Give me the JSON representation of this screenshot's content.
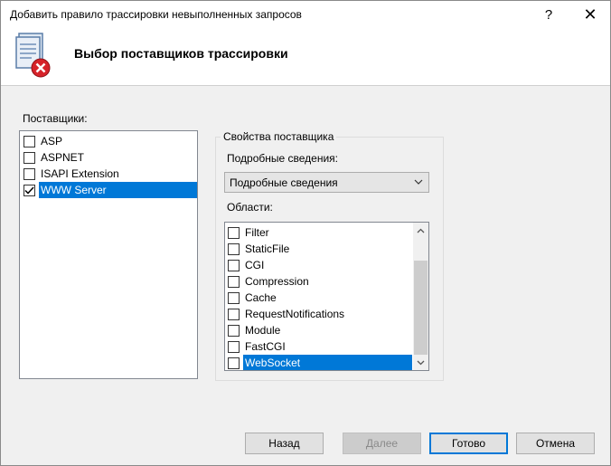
{
  "window": {
    "title": "Добавить правило трассировки невыполненных запросов",
    "help_glyph": "?",
    "close_glyph": "✕"
  },
  "header": {
    "title": "Выбор поставщиков трассировки",
    "icon": "trace-rule-error-icon"
  },
  "providers": {
    "label": "Поставщики:",
    "items": [
      {
        "label": "ASP",
        "checked": false,
        "selected": false
      },
      {
        "label": "ASPNET",
        "checked": false,
        "selected": false
      },
      {
        "label": "ISAPI Extension",
        "checked": false,
        "selected": false
      },
      {
        "label": "WWW Server",
        "checked": true,
        "selected": true
      }
    ]
  },
  "properties": {
    "legend": "Свойства поставщика",
    "verbosity_label": "Подробные сведения:",
    "verbosity_value": "Подробные сведения",
    "areas_label": "Области:",
    "areas": [
      {
        "label": "Filter",
        "checked": false,
        "selected": false
      },
      {
        "label": "StaticFile",
        "checked": false,
        "selected": false
      },
      {
        "label": "CGI",
        "checked": false,
        "selected": false
      },
      {
        "label": "Compression",
        "checked": false,
        "selected": false
      },
      {
        "label": "Cache",
        "checked": false,
        "selected": false
      },
      {
        "label": "RequestNotifications",
        "checked": false,
        "selected": false
      },
      {
        "label": "Module",
        "checked": false,
        "selected": false
      },
      {
        "label": "FastCGI",
        "checked": false,
        "selected": false
      },
      {
        "label": "WebSocket",
        "checked": false,
        "selected": true
      }
    ]
  },
  "buttons": {
    "back": "Назад",
    "next": "Далее",
    "finish": "Готово",
    "cancel": "Отмена"
  },
  "colors": {
    "selection": "#0078d7",
    "dialog_bg": "#f0f0f0"
  }
}
